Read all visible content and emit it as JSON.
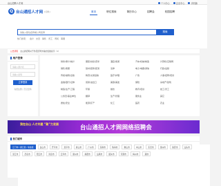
{
  "topbar": {
    "site": "台山招聘人才网",
    "links": [
      "个人中心",
      "企业中心",
      "手机版"
    ]
  },
  "logo": {
    "text": "台山通招人才网",
    "city": "台山",
    "switch": "[切换]"
  },
  "nav": {
    "items": [
      "首页",
      "职位搜索",
      "简历中心",
      "招聘会",
      "校园招聘"
    ],
    "active": 0
  },
  "search": {
    "placeholder": "请输入职位名称或公司名称",
    "button": "搜索"
  },
  "hot": {
    "label": "热门搜索：",
    "terms": [
      "会计",
      "文员",
      "销售",
      "普工",
      "司机",
      "客服"
    ]
  },
  "notice": {
    "tag": "公告通知",
    "text": "台山通招网关于防范招聘诈骗的温馨提示（1）"
  },
  "login": {
    "title": "用户登录",
    "user_placeholder": "请输入用户名",
    "pass_placeholder": "请输入密码",
    "button": "立即登录",
    "register": "免费注册 | 忘记密码"
  },
  "categories": [
    "财务/审计/统计",
    "服装/纺织/皮革",
    "酒店/旅游",
    "汽车/机械/制造",
    "计算机/互联网",
    "销售/客服",
    "建材/装修/装潢",
    "法律",
    "电子/电器/通信",
    "行政/后勤",
    "传媒/编辑/出版",
    "物流/交通运输",
    "医疗/护理",
    "广告",
    "人事/招聘/培训",
    "金融/银行/证券",
    "贸易/进出口",
    "美容/美发",
    "保险",
    "房地产/建筑",
    "制造/生产/工程",
    "环保",
    "餐饮",
    "教育/培训",
    "技工/普工",
    "公务员/事业单位",
    "翻译",
    "生产/管理",
    "服务业",
    "其它",
    "质检/安全",
    "能源/矿产",
    "化工",
    "医药",
    "农业"
  ],
  "banner": {
    "sub": "我在台山 人才共建 “聚”力发展",
    "title": "台山通招人才网网络招聘会"
  },
  "cities": {
    "title": "热门城市",
    "list": [
      "江门市 / 蓬江区 / 新会区",
      "台山市",
      "开平市",
      "恩平市",
      "鹤山市",
      "广州市",
      "深圳市",
      "珠海市",
      "佛山市",
      "中山市",
      "东莞市",
      "惠州市",
      "肇庆市",
      "汕头市",
      "湛江市",
      "茂名市",
      "阳江市",
      "清远市",
      "云浮市",
      "潮州市",
      "揭阳市",
      "汕尾市",
      "韶关市",
      "河源市",
      "梅州市",
      "其他"
    ],
    "selected": 0
  }
}
